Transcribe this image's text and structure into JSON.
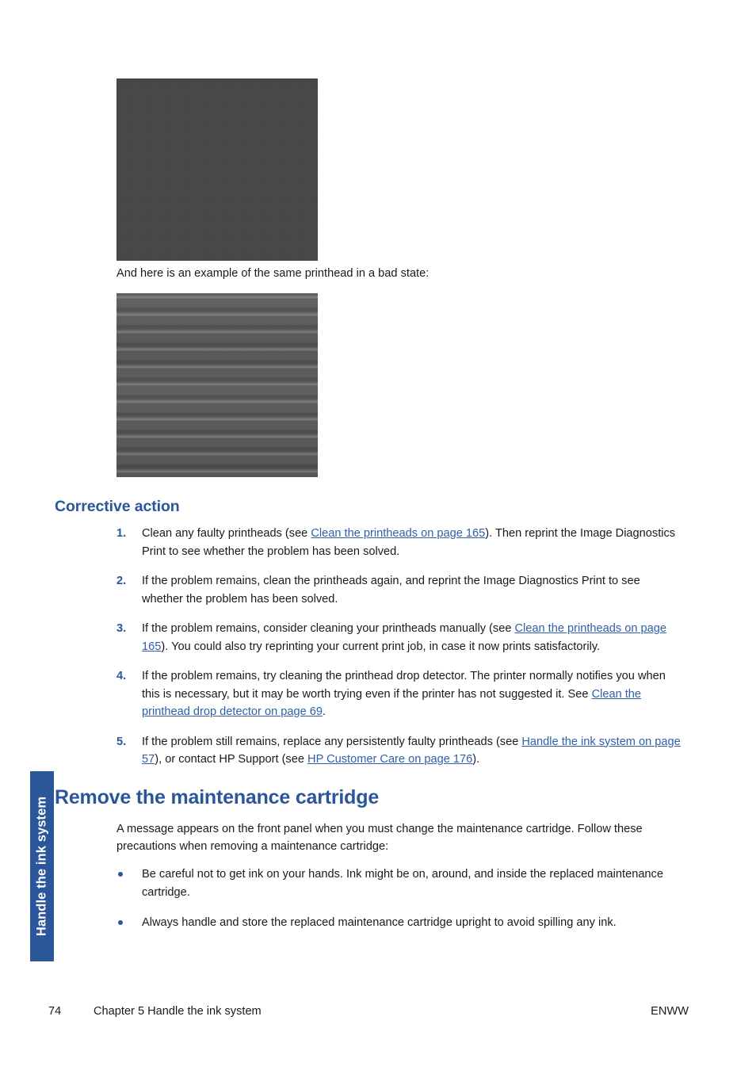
{
  "side_tab": {
    "label": "Handle the ink system",
    "color": "#2B5699"
  },
  "images": {
    "good_printhead_alt": "printhead-good-state-sample",
    "bad_printhead_alt": "printhead-bad-state-sample"
  },
  "caption": {
    "bad_state": "And here is an example of the same printhead in a bad state:"
  },
  "headings": {
    "corrective_action": "Corrective action",
    "remove_cartridge": "Remove the maintenance cartridge"
  },
  "colors": {
    "heading_blue": "#2B5699",
    "link_blue": "#3060A8",
    "body_text": "#1a1a1a"
  },
  "steps": [
    {
      "number": "1.",
      "parts": [
        {
          "type": "text",
          "text": "Clean any faulty printheads (see "
        },
        {
          "type": "link",
          "text": "Clean the printheads on page 165"
        },
        {
          "type": "text",
          "text": "). Then reprint the Image Diagnostics Print to see whether the problem has been solved."
        }
      ]
    },
    {
      "number": "2.",
      "parts": [
        {
          "type": "text",
          "text": "If the problem remains, clean the printheads again, and reprint the Image Diagnostics Print to see whether the problem has been solved."
        }
      ]
    },
    {
      "number": "3.",
      "parts": [
        {
          "type": "text",
          "text": "If the problem remains, consider cleaning your printheads manually (see "
        },
        {
          "type": "link",
          "text": "Clean the printheads on page 165"
        },
        {
          "type": "text",
          "text": "). You could also try reprinting your current print job, in case it now prints satisfactorily."
        }
      ]
    },
    {
      "number": "4.",
      "parts": [
        {
          "type": "text",
          "text": "If the problem remains, try cleaning the printhead drop detector. The printer normally notifies you when this is necessary, but it may be worth trying even if the printer has not suggested it. See "
        },
        {
          "type": "link",
          "text": "Clean the printhead drop detector on page 69"
        },
        {
          "type": "text",
          "text": "."
        }
      ]
    },
    {
      "number": "5.",
      "parts": [
        {
          "type": "text",
          "text": "If the problem still remains, replace any persistently faulty printheads (see "
        },
        {
          "type": "link",
          "text": "Handle the ink system on page 57"
        },
        {
          "type": "text",
          "text": "), or contact HP Support (see "
        },
        {
          "type": "link",
          "text": "HP Customer Care on page 176"
        },
        {
          "type": "text",
          "text": ")."
        }
      ]
    }
  ],
  "remove_cartridge": {
    "intro": "A message appears on the front panel when you must change the maintenance cartridge. Follow these precautions when removing a maintenance cartridge:",
    "bullets": [
      "Be careful not to get ink on your hands. Ink might be on, around, and inside the replaced maintenance cartridge.",
      "Always handle and store the replaced maintenance cartridge upright to avoid spilling any ink."
    ]
  },
  "footer": {
    "page_number": "74",
    "chapter": "Chapter 5   Handle the ink system",
    "locale": "ENWW"
  }
}
